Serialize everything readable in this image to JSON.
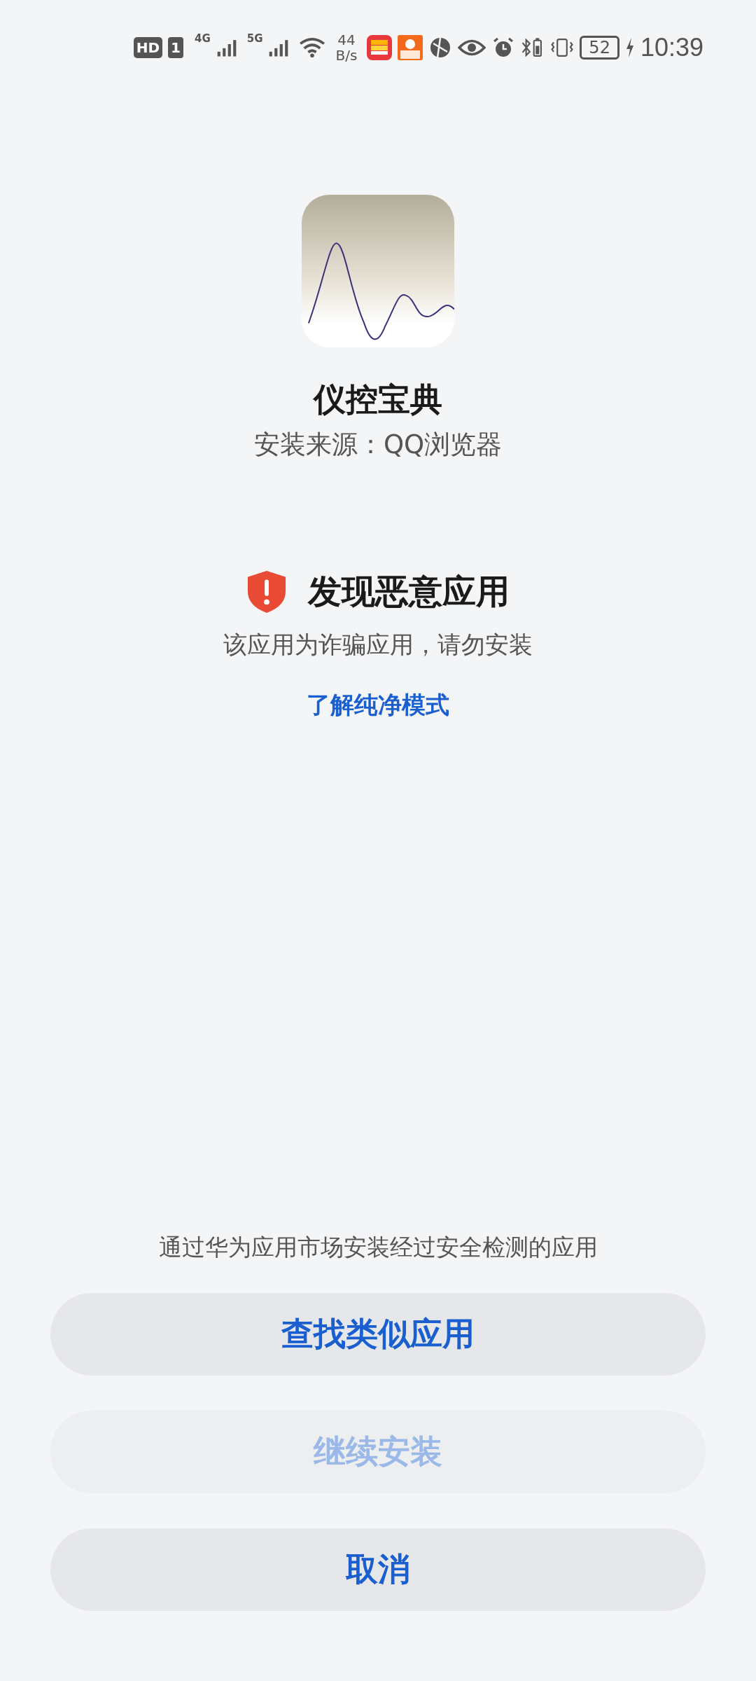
{
  "status_bar": {
    "sim_badge": "HD",
    "sim_slot": "1",
    "network_1": "4G",
    "network_2": "5G",
    "speed_value": "44",
    "speed_unit": "B/s",
    "battery": "52",
    "time": "10:39"
  },
  "app": {
    "name": "仪控宝典",
    "source": "安装来源：QQ浏览器"
  },
  "warning": {
    "title": "发现恶意应用",
    "message": "该应用为诈骗应用，请勿安装",
    "link": "了解纯净模式"
  },
  "hint": "通过华为应用市场安装经过安全检测的应用",
  "buttons": [
    {
      "label": "查找类似应用",
      "disabled": false
    },
    {
      "label": "继续安装",
      "disabled": true
    },
    {
      "label": "取消",
      "disabled": false
    }
  ]
}
